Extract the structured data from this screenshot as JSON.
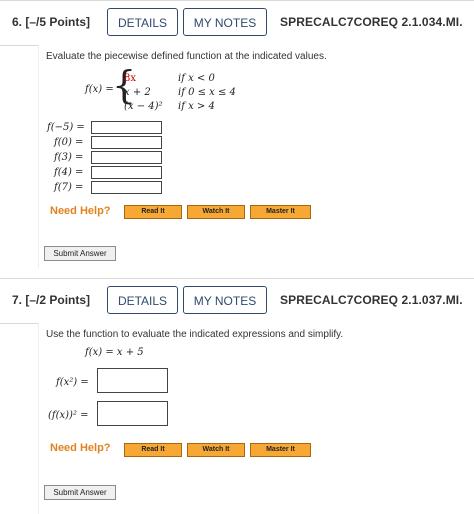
{
  "q6": {
    "number": "6.",
    "points": "[–/5 Points]",
    "details": "DETAILS",
    "my_notes": "MY NOTES",
    "id": "SPRECALC7COREQ 2.1.034.MI.",
    "instruction": "Evaluate the piecewise defined function at the indicated values.",
    "fx": "f(x) =",
    "cases": [
      {
        "expr": "8x",
        "cond": "if x < 0"
      },
      {
        "expr": "x + 2",
        "cond": "if 0 ≤ x ≤ 4"
      },
      {
        "expr": "(x − 4)²",
        "cond": "if x > 4"
      }
    ],
    "items": [
      "f(−5) =",
      "f(0) =",
      "f(3) =",
      "f(4) =",
      "f(7) ="
    ],
    "need_help": "Need Help?",
    "read_it": "Read It",
    "watch_it": "Watch It",
    "master_it": "Master It",
    "submit": "Submit Answer"
  },
  "q7": {
    "number": "7.",
    "points": "[–/2 Points]",
    "details": "DETAILS",
    "my_notes": "MY NOTES",
    "id": "SPRECALC7COREQ 2.1.037.MI.",
    "instruction": "Use the function to evaluate the indicated expressions and simplify.",
    "function": "f(x) = x + 5",
    "items": [
      "f(x²) =",
      "(f(x))² ="
    ],
    "need_help": "Need Help?",
    "read_it": "Read It",
    "watch_it": "Watch It",
    "master_it": "Master It",
    "submit": "Submit Answer"
  },
  "colors": {
    "accent": "#2f4a6d",
    "help_orange": "#e0831e",
    "help_button": "#f7a733",
    "red_math": "#cc0000"
  }
}
